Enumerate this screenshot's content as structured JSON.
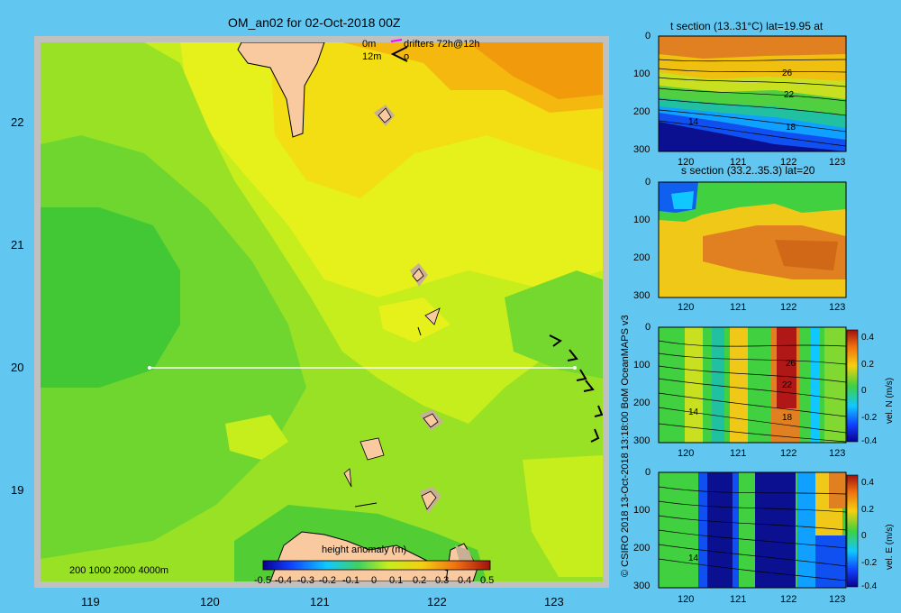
{
  "main_map": {
    "title": "OM_an02 for 02-Oct-2018 00Z",
    "legend_0m": "0m",
    "legend_12m": "12m",
    "legend_drifters": "drifters 72h@12h",
    "legend_arrow_mark": "o",
    "x_ticks": [
      "119",
      "120",
      "121",
      "122",
      "123"
    ],
    "y_ticks": [
      "22",
      "21",
      "20",
      "19"
    ],
    "depth_label": "200  1000  2000  4000m",
    "colorbar_title": "height anomaly (m)",
    "colorbar_ticks": [
      "-0.5",
      "-0.4",
      "-0.3",
      "-0.2",
      "-0.1",
      "0",
      "0.1",
      "0.2",
      "0.3",
      "0.4",
      "0.5"
    ],
    "colors": {
      "land": "#f9c9a0",
      "shelf": "#c8b097",
      "frame": "#c0c0c0",
      "transect": "#ffffff"
    }
  },
  "credit": "© CSIRO 2018  13-Oct-2018 13:18:00 BoM OceanMAPS v3",
  "panels": [
    {
      "id": "t-section",
      "title": "t section (13..31°C) lat=19.95 at",
      "y_ticks": [
        "0",
        "100",
        "200",
        "300"
      ],
      "x_ticks": [
        "120",
        "121",
        "122",
        "123"
      ],
      "contour_labels": [
        "26",
        "22",
        "18",
        "14"
      ]
    },
    {
      "id": "s-section",
      "title": "s section (33.2..35.3) lat=20",
      "y_ticks": [
        "0",
        "100",
        "200",
        "300"
      ],
      "x_ticks": [
        "120",
        "121",
        "122",
        "123"
      ]
    },
    {
      "id": "vel-n",
      "y_ticks": [
        "0",
        "100",
        "200",
        "300"
      ],
      "x_ticks": [
        "120",
        "121",
        "122",
        "123"
      ],
      "contour_labels": [
        "26",
        "22",
        "18",
        "14"
      ],
      "cbar_label": "vel. N (m/s)",
      "cbar_ticks": [
        "0.4",
        "0.2",
        "0",
        "-0.2",
        "-0.4"
      ]
    },
    {
      "id": "vel-e",
      "y_ticks": [
        "0",
        "100",
        "200",
        "300"
      ],
      "x_ticks": [
        "120",
        "121",
        "122",
        "123"
      ],
      "contour_labels": [
        "14"
      ],
      "cbar_label": "vel. E (m/s)",
      "cbar_ticks": [
        "0.4",
        "0.2",
        "0",
        "-0.2",
        "-0.4"
      ]
    }
  ]
}
